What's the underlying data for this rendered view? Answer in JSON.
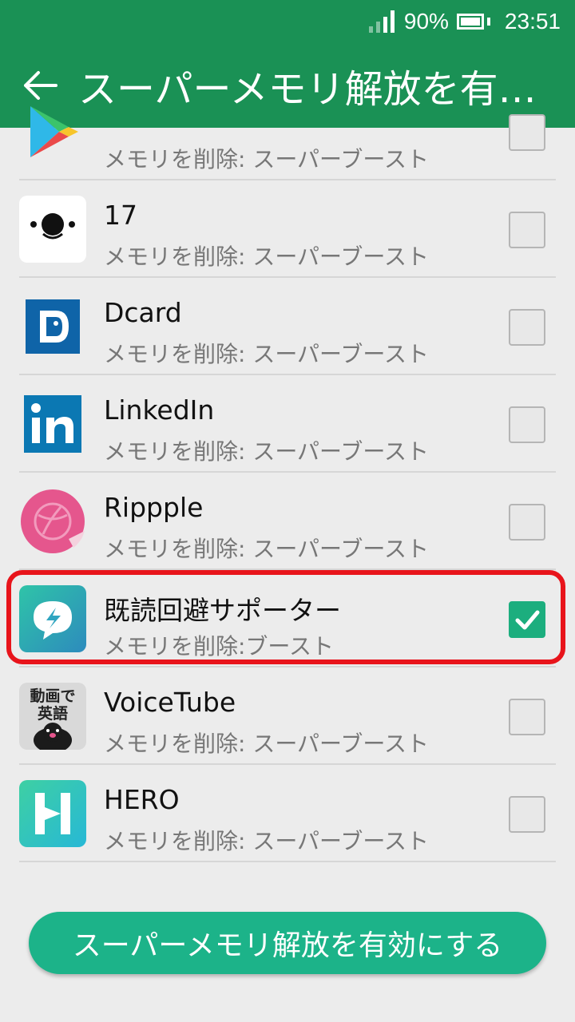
{
  "status": {
    "battery": "90%",
    "time": "23:51"
  },
  "appbar": {
    "title": "スーパーメモリ解放を有効にする"
  },
  "apps": [
    {
      "name": "",
      "mode": "メモリを削除: スーパーブースト",
      "checked": false,
      "icon": "google-play-icon"
    },
    {
      "name": "17",
      "mode": "メモリを削除: スーパーブースト",
      "checked": false,
      "icon": "17-app-icon"
    },
    {
      "name": "Dcard",
      "mode": "メモリを削除: スーパーブースト",
      "checked": false,
      "icon": "dcard-icon"
    },
    {
      "name": "LinkedIn",
      "mode": "メモリを削除: スーパーブースト",
      "checked": false,
      "icon": "linkedin-icon"
    },
    {
      "name": "Rippple",
      "mode": "メモリを削除: スーパーブースト",
      "checked": false,
      "icon": "rippple-icon"
    },
    {
      "name": "既読回避サポーター",
      "mode": "メモリを削除:ブースト",
      "checked": true,
      "icon": "kidoku-icon"
    },
    {
      "name": "VoiceTube",
      "mode": "メモリを削除: スーパーブースト",
      "checked": false,
      "icon": "voicetube-icon",
      "icon_text": [
        "動画で",
        "英語"
      ]
    },
    {
      "name": "HERO",
      "mode": "メモリを削除: スーパーブースト",
      "checked": false,
      "icon": "hero-icon"
    }
  ],
  "button": {
    "label": "スーパーメモリ解放を有効にする"
  },
  "colors": {
    "primary": "#1a9155",
    "accent": "#1cb389",
    "highlight": "#e8141b"
  }
}
